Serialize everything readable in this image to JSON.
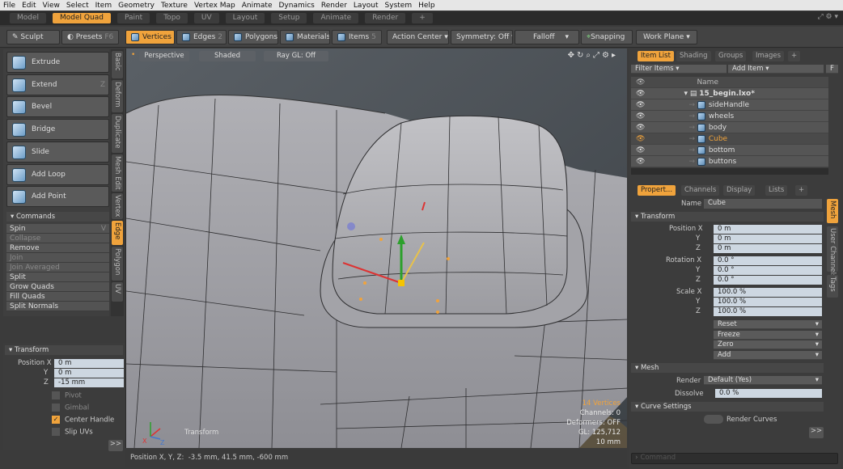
{
  "menu": [
    "File",
    "Edit",
    "View",
    "Select",
    "Item",
    "Geometry",
    "Texture",
    "Vertex Map",
    "Animate",
    "Dynamics",
    "Render",
    "Layout",
    "System",
    "Help"
  ],
  "layout_tabs": [
    "Model",
    "Model Quad",
    "Paint",
    "Topo",
    "UV",
    "Layout",
    "Setup",
    "Animate",
    "Render",
    "+"
  ],
  "active_layout_tab": "Model Quad",
  "toolbar": {
    "sculpt": "Sculpt",
    "presets": "Presets",
    "presets_key": "F6",
    "vertices": "Vertices",
    "edges": "Edges",
    "edges_key": "2",
    "polygons": "Polygons",
    "materials": "Materials",
    "items": "Items",
    "items_key": "5",
    "action_center": "Action Center",
    "symmetry": "Symmetry: Off",
    "falloff": "Falloff",
    "snapping": "Snapping",
    "work_plane": "Work Plane"
  },
  "tools": [
    {
      "label": "Extrude",
      "key": ""
    },
    {
      "label": "Extend",
      "key": "Z"
    },
    {
      "label": "Bevel",
      "key": ""
    },
    {
      "label": "Bridge",
      "key": ""
    },
    {
      "label": "Slide",
      "key": ""
    },
    {
      "label": "Add Loop",
      "key": ""
    },
    {
      "label": "Add Point",
      "key": ""
    }
  ],
  "commands": {
    "title": "Commands",
    "items": [
      {
        "label": "Spin",
        "key": "V",
        "dim": false
      },
      {
        "label": "Collapse",
        "dim": true
      },
      {
        "label": "Remove",
        "dim": false
      },
      {
        "label": "Join",
        "dim": true
      },
      {
        "label": "Join Averaged",
        "dim": true
      },
      {
        "label": "Split",
        "dim": false
      },
      {
        "label": "Grow Quads",
        "dim": false
      },
      {
        "label": "Fill Quads",
        "dim": false
      },
      {
        "label": "Split Normals",
        "dim": false
      }
    ]
  },
  "vtabs": [
    "Basic",
    "Deform",
    "Duplicate",
    "Mesh Edit",
    "Vertex",
    "Edge",
    "Polygon",
    "UV"
  ],
  "active_vtab": "Edge",
  "transform_panel": {
    "title": "Transform",
    "position_label": "Position X",
    "y": "Y",
    "z": "Z",
    "x_val": "0 m",
    "y_val": "0 m",
    "z_val": "-15 mm",
    "pivot": "Pivot",
    "gimbal": "Gimbal",
    "center_handle": "Center Handle",
    "slip_uvs": "Slip UVs",
    "more": ">>"
  },
  "viewport": {
    "view": "Perspective",
    "shading": "Shaded",
    "raygl": "Ray GL: Off",
    "tool_name": "Transform",
    "hud": [
      "14 Vertices",
      "Channels: 0",
      "Deformers: OFF",
      "GL: 125,712",
      "10 mm"
    ]
  },
  "status": {
    "label": "Position X, Y, Z:",
    "value": "-3.5 mm, 41.5 mm, -600 mm"
  },
  "item_list": {
    "tabs": [
      "Item List",
      "Shading",
      "Groups",
      "Images",
      "+"
    ],
    "filter": "Filter Items",
    "add_item": "Add Item",
    "f_btn": "F",
    "name_header": "Name",
    "scene": "15_begin.lxo*",
    "items": [
      "sideHandle",
      "wheels",
      "body",
      "Cube",
      "bottom",
      "buttons"
    ],
    "selected": "Cube"
  },
  "properties": {
    "tabs": [
      "Propert...",
      "Channels",
      "Display",
      "Lists",
      "+"
    ],
    "side_tabs": [
      "Mesh",
      "User Channels",
      "Tags"
    ],
    "name_label": "Name",
    "name_value": "Cube",
    "transform": "Transform",
    "position_label": "Position X",
    "rotation_label": "Rotation X",
    "scale_label": "Scale X",
    "y": "Y",
    "z": "Z",
    "pos": [
      "0 m",
      "0 m",
      "0 m"
    ],
    "rot": [
      "0.0 °",
      "0.0 °",
      "0.0 °"
    ],
    "scale": [
      "100.0 %",
      "100.0 %",
      "100.0 %"
    ],
    "actions": [
      "Reset",
      "Freeze",
      "Zero",
      "Add"
    ],
    "mesh": "Mesh",
    "render_label": "Render",
    "render_value": "Default (Yes)",
    "dissolve_label": "Dissolve",
    "dissolve_value": "0.0 %",
    "curve_settings": "Curve Settings",
    "render_curves": "Render Curves",
    "more": ">>",
    "command_placeholder": "Command"
  },
  "colors": {
    "accent": "#f0a33c",
    "viewport": "#4e545a",
    "mesh": "#9a9aa0"
  }
}
